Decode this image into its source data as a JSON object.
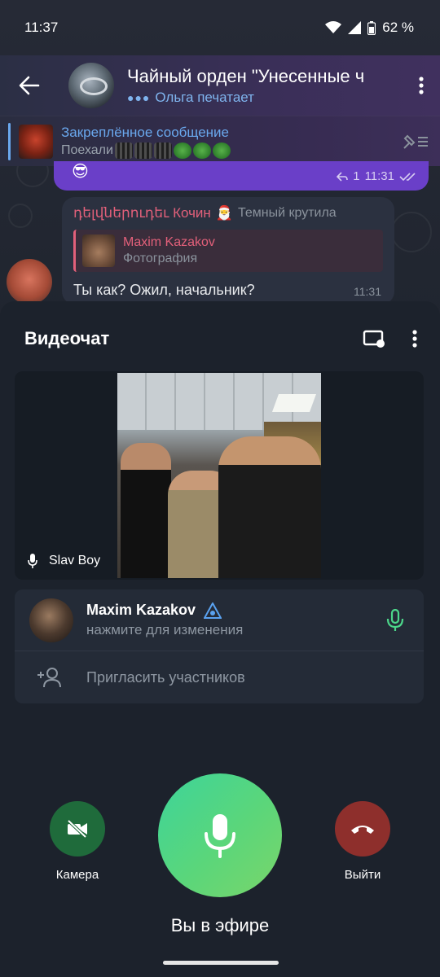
{
  "status_bar": {
    "time": "11:37",
    "battery": "62 %"
  },
  "chat": {
    "title": "Чайный орден \"Унесенные ч",
    "typing": "Ольга печатает",
    "pinned": {
      "title": "Закреплённое сообщение",
      "preview": "Поехали"
    },
    "outgoing": {
      "replies": "1",
      "time": "11:31"
    },
    "incoming": {
      "sender": "դելվներուդեւ Кочин",
      "rank": "Темный крутила",
      "reply_name": "Maxim Kazakov",
      "reply_kind": "Фотография",
      "text": "Ты как? Ожил, начальник?",
      "time": "11:31"
    }
  },
  "videochat": {
    "title": "Видеочат",
    "video_label": "Slav Boy",
    "participant": {
      "name": "Maxim Kazakov",
      "status": "нажмите для изменения"
    },
    "invite_label": "Пригласить участников",
    "camera_label": "Камера",
    "leave_label": "Выйти",
    "on_air": "Вы в эфире"
  },
  "colors": {
    "accent_green": "#4cd68a",
    "leave_red": "#8e2f2c",
    "link_blue": "#6aa8ee",
    "sender_pink": "#e2607a"
  }
}
